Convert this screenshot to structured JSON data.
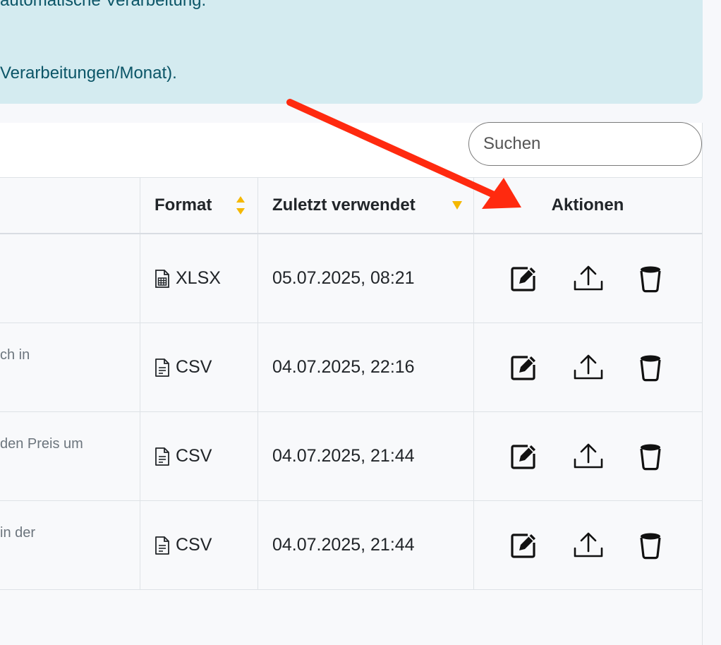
{
  "alert": {
    "line1": "automatische Verarbeitung.",
    "line2": "Verarbeitungen/Monat)."
  },
  "search": {
    "placeholder": "Suchen"
  },
  "table": {
    "headers": {
      "format": "Format",
      "last_used": "Zuletzt verwendet",
      "actions": "Aktionen"
    },
    "rows": [
      {
        "description": "",
        "format": "XLSX",
        "format_icon": "spreadsheet-file-icon",
        "last_used": "05.07.2025, 08:21"
      },
      {
        "description": "ch in",
        "format": "CSV",
        "format_icon": "text-file-icon",
        "last_used": "04.07.2025, 22:16"
      },
      {
        "description": "den Preis um",
        "format": "CSV",
        "format_icon": "text-file-icon",
        "last_used": "04.07.2025, 21:44"
      },
      {
        "description": "in der",
        "format": "CSV",
        "format_icon": "text-file-icon",
        "last_used": "04.07.2025, 21:44"
      }
    ],
    "action_icons": [
      "edit-icon",
      "upload-icon",
      "delete-icon"
    ]
  },
  "colors": {
    "alert_bg": "#d4ebf0",
    "alert_text": "#0b5567",
    "sort_active": "#f5b800",
    "annotation_arrow": "#ff2a0f"
  }
}
